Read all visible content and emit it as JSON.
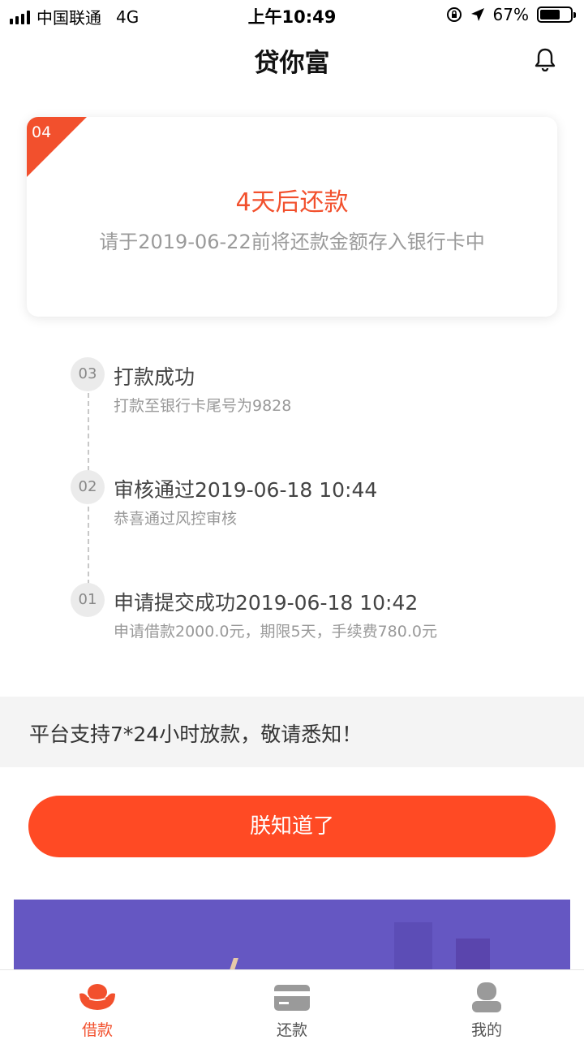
{
  "status_bar": {
    "carrier": "中国联通",
    "network": "4G",
    "time": "上午10:49",
    "battery": "67%",
    "battery_level": 0.67
  },
  "nav": {
    "title": "贷你富",
    "right_icon": "bell-icon"
  },
  "card": {
    "badge": "04",
    "title": "4天后还款",
    "subtitle": "请于2019-06-22前将还款金额存入银行卡中",
    "accent_color": "#f2502d"
  },
  "timeline": [
    {
      "num": "03",
      "title": "打款成功",
      "desc": "打款至银行卡尾号为9828"
    },
    {
      "num": "02",
      "title": "审核通过2019-06-18 10:44",
      "desc": "恭喜通过风控审核"
    },
    {
      "num": "01",
      "title": "申请提交成功2019-06-18 10:42",
      "desc": "申请借款2000.0元，期限5天，手续费780.0元"
    }
  ],
  "notice": {
    "text": "平台支持7*24小时放款，敬请悉知！"
  },
  "confirm_button": {
    "label": "朕知道了",
    "color": "#ff4a24"
  },
  "banner": {
    "background": "#6557c2"
  },
  "tabbar": {
    "items": [
      {
        "label": "借款",
        "icon": "ingot-icon",
        "active": true
      },
      {
        "label": "还款",
        "icon": "card-icon",
        "active": false
      },
      {
        "label": "我的",
        "icon": "user-icon",
        "active": false
      }
    ]
  }
}
